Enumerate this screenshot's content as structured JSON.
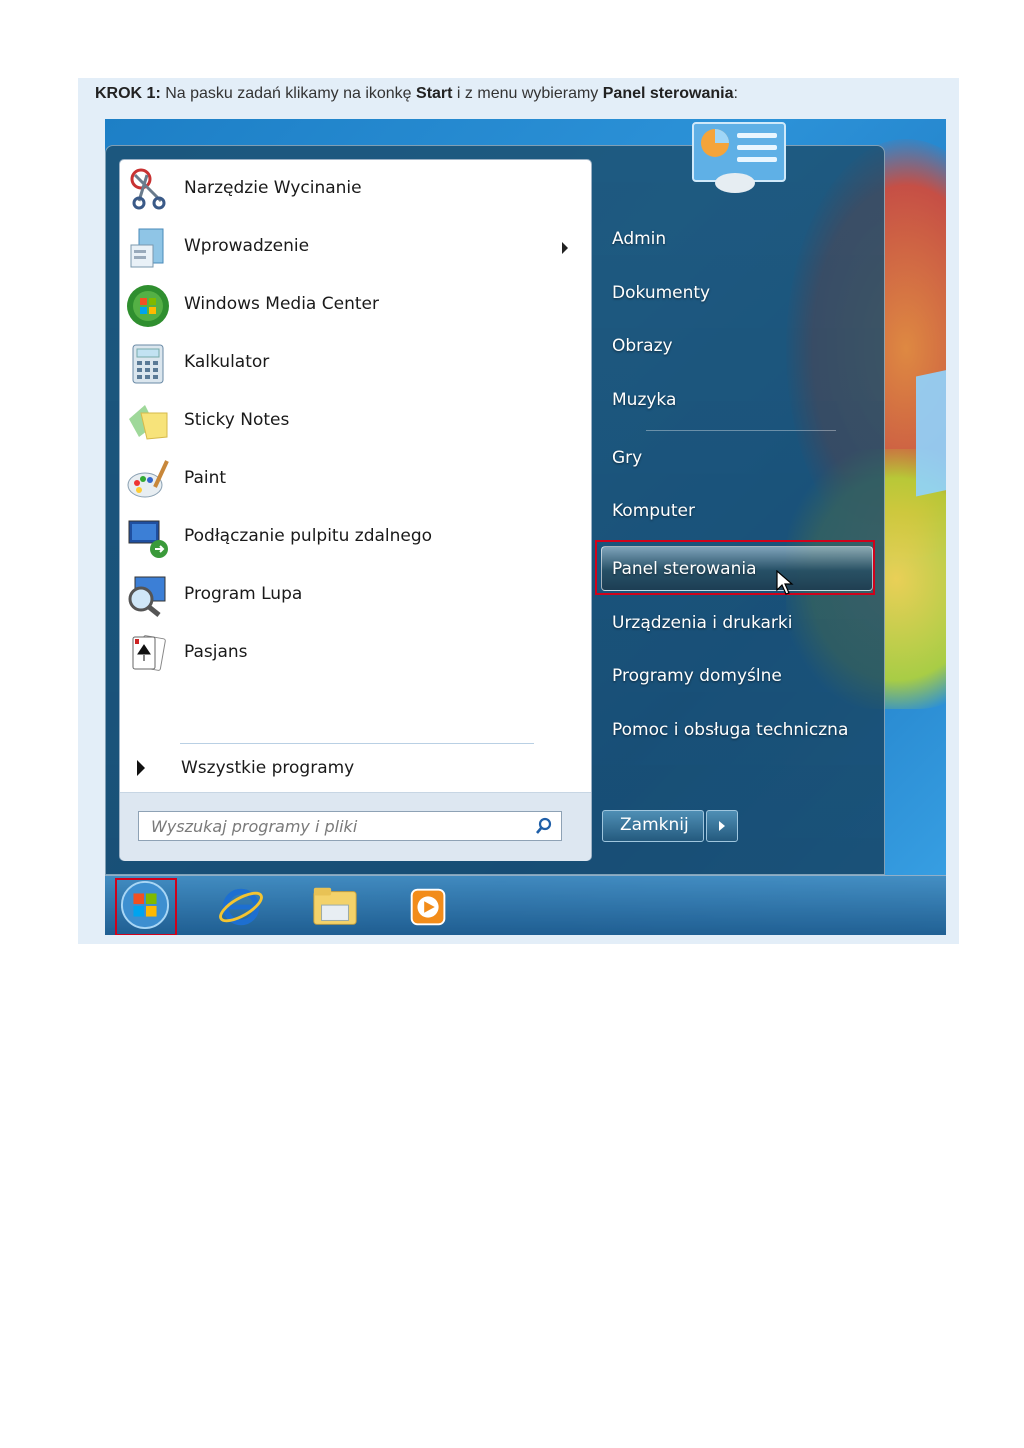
{
  "instruction": {
    "step_label": "KROK 1:",
    "text_1": " Na pasku zadań klikamy na ikonkę ",
    "start_word": "Start",
    "text_2": " i z menu wybieramy ",
    "panel_word": "Panel sterowania",
    "text_3": ":"
  },
  "start_menu": {
    "programs": [
      {
        "label": "Narzędzie Wycinanie",
        "icon": "snipping-tool-icon"
      },
      {
        "label": "Wprowadzenie",
        "icon": "getting-started-icon",
        "has_submenu": true
      },
      {
        "label": "Windows Media Center",
        "icon": "media-center-icon"
      },
      {
        "label": "Kalkulator",
        "icon": "calculator-icon"
      },
      {
        "label": "Sticky Notes",
        "icon": "sticky-notes-icon"
      },
      {
        "label": "Paint",
        "icon": "paint-icon"
      },
      {
        "label": "Podłączanie pulpitu zdalnego",
        "icon": "remote-desktop-icon"
      },
      {
        "label": "Program Lupa",
        "icon": "magnifier-icon"
      },
      {
        "label": "Pasjans",
        "icon": "solitaire-icon"
      }
    ],
    "all_programs": "Wszystkie programy",
    "search_placeholder": "Wyszukaj programy i pliki",
    "right_items": [
      "Admin",
      "Dokumenty",
      "Obrazy",
      "Muzyka",
      "Gry",
      "Komputer",
      "Panel sterowania",
      "Urządzenia i drukarki",
      "Programy domyślne",
      "Pomoc i obsługa techniczna"
    ],
    "selected_item": "Panel sterowania",
    "shutdown_label": "Zamknij"
  },
  "taskbar": {
    "items": [
      "start-orb-icon",
      "internet-explorer-icon",
      "explorer-folder-icon",
      "media-player-icon"
    ]
  },
  "colors": {
    "highlight_border": "#d0021b",
    "menu_background": "#1c4e6e",
    "desktop": "#1d7fc6"
  }
}
